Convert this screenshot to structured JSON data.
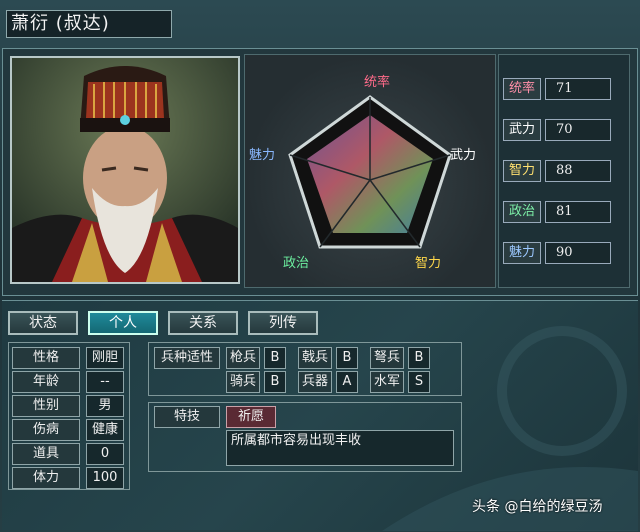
{
  "character": {
    "name": "萧衍",
    "style_name": "(叔达)"
  },
  "radar": {
    "axis_labels": [
      "统率",
      "武力",
      "智力",
      "政治",
      "魅力"
    ],
    "axis_colors": [
      "#ff6b8a",
      "#ffffff",
      "#ffd84a",
      "#6cf0a0",
      "#8ab8ff"
    ]
  },
  "stats": [
    {
      "label": "统率",
      "value": "71",
      "color": "#ff8fa8"
    },
    {
      "label": "武力",
      "value": "70",
      "color": "#ffffff"
    },
    {
      "label": "智力",
      "value": "88",
      "color": "#ffe070"
    },
    {
      "label": "政治",
      "value": "81",
      "color": "#7df0a8"
    },
    {
      "label": "魅力",
      "value": "90",
      "color": "#9cc8ff"
    }
  ],
  "tabs": [
    "状态",
    "个人",
    "关系",
    "列传"
  ],
  "active_tab": "个人",
  "personal": [
    {
      "label": "性格",
      "value": "刚胆"
    },
    {
      "label": "年龄",
      "value": "--"
    },
    {
      "label": "性别",
      "value": "男"
    },
    {
      "label": "伤病",
      "value": "健康"
    },
    {
      "label": "道具",
      "value": "0"
    },
    {
      "label": "体力",
      "value": "100"
    }
  ],
  "aptitude": {
    "title": "兵种适性",
    "items": [
      {
        "label": "枪兵",
        "value": "B"
      },
      {
        "label": "戟兵",
        "value": "B"
      },
      {
        "label": "弩兵",
        "value": "B"
      },
      {
        "label": "骑兵",
        "value": "B"
      },
      {
        "label": "兵器",
        "value": "A"
      },
      {
        "label": "水军",
        "value": "S"
      }
    ]
  },
  "skill": {
    "title": "特技",
    "name": "祈愿",
    "description": "所属都市容易出现丰收"
  },
  "watermark": "头条 @白给的绿豆汤"
}
